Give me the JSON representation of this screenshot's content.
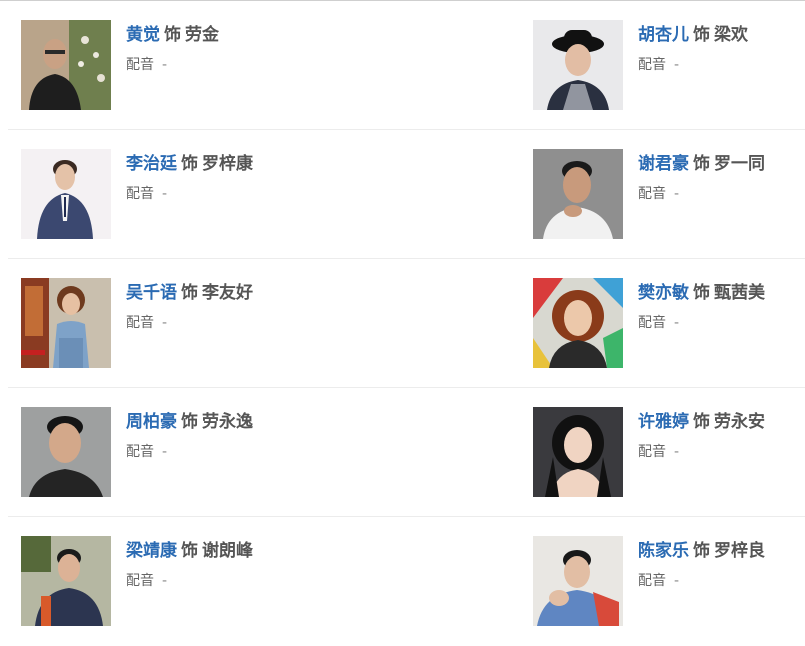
{
  "cast": [
    {
      "actor": "黄觉",
      "connector": "饰",
      "role": "劳金",
      "dub_label": "配音",
      "dub_value": "-"
    },
    {
      "actor": "胡杏儿",
      "connector": "饰",
      "role": "梁欢",
      "dub_label": "配音",
      "dub_value": "-"
    },
    {
      "actor": "李治廷",
      "connector": "饰",
      "role": "罗梓康",
      "dub_label": "配音",
      "dub_value": "-"
    },
    {
      "actor": "谢君豪",
      "connector": "饰",
      "role": "罗一同",
      "dub_label": "配音",
      "dub_value": "-"
    },
    {
      "actor": "吴千语",
      "connector": "饰",
      "role": "李友好",
      "dub_label": "配音",
      "dub_value": "-"
    },
    {
      "actor": "樊亦敏",
      "connector": "饰",
      "role": "甄茜美",
      "dub_label": "配音",
      "dub_value": "-"
    },
    {
      "actor": "周柏豪",
      "connector": "饰",
      "role": "劳永逸",
      "dub_label": "配音",
      "dub_value": "-"
    },
    {
      "actor": "许雅婷",
      "connector": "饰",
      "role": "劳永安",
      "dub_label": "配音",
      "dub_value": "-"
    },
    {
      "actor": "梁靖康",
      "connector": "饰",
      "role": "谢朗峰",
      "dub_label": "配音",
      "dub_value": "-"
    },
    {
      "actor": "陈家乐",
      "connector": "饰",
      "role": "罗梓良",
      "dub_label": "配音",
      "dub_value": "-"
    }
  ],
  "colors": {
    "actor_link": "#2b6bb3",
    "role_text": "#555555",
    "divider": "#ececec"
  }
}
